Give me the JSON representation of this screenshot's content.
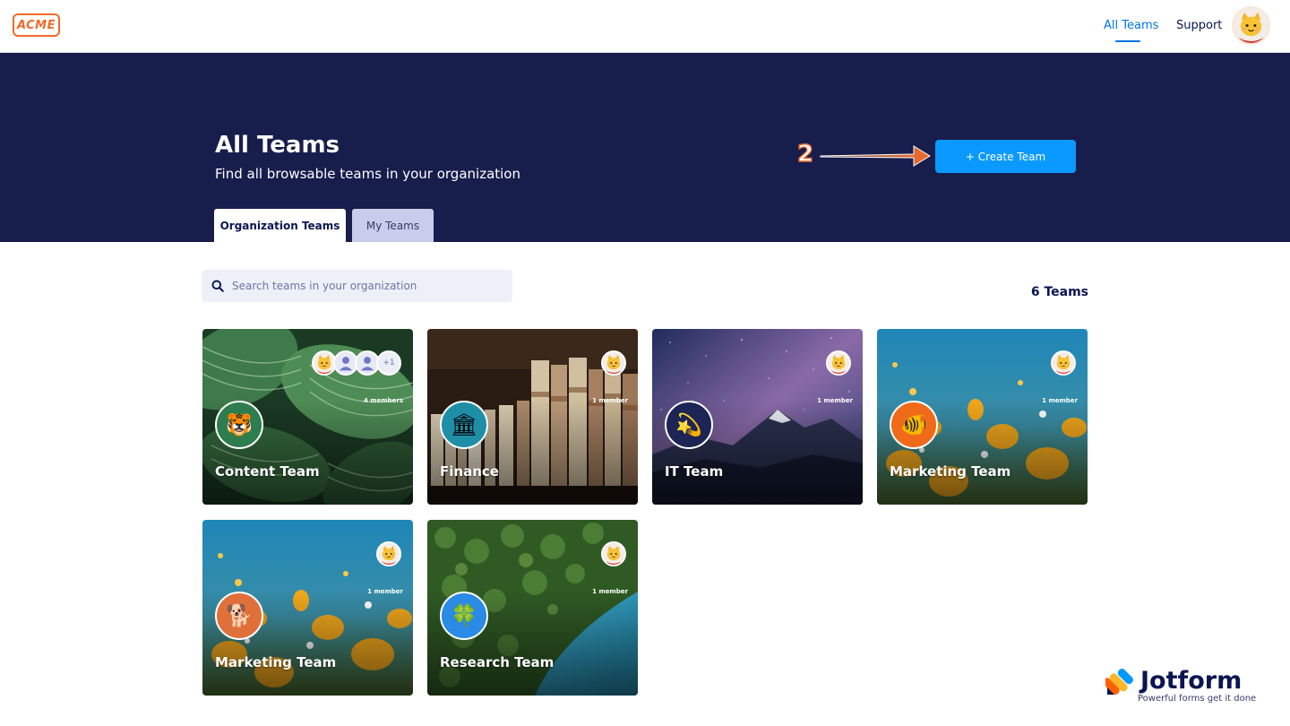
{
  "brand": {
    "logo_text": "ACME",
    "accent": "#f06a2a"
  },
  "nav": {
    "all_teams": "All Teams",
    "support": "Support",
    "avatar_icon": "cat-avatar-icon"
  },
  "hero": {
    "title": "All Teams",
    "subtitle": "Find all browsable teams in your organization",
    "create_button": "+ Create Team",
    "step_marker": "2",
    "background": "#171e4c",
    "button_color": "#0a99ff"
  },
  "tabs": [
    {
      "label": "Organization Teams",
      "active": true
    },
    {
      "label": "My Teams",
      "active": false
    }
  ],
  "search": {
    "placeholder": "Search teams in your organization",
    "value": ""
  },
  "team_count": "6 Teams",
  "teams": [
    {
      "name": "Content Team",
      "members": "4 members",
      "icon": "tiger-icon",
      "extra_members": "+1",
      "theme": "green-leaves"
    },
    {
      "name": "Finance",
      "members": "1 member",
      "icon": "bank-icon",
      "theme": "library-books"
    },
    {
      "name": "IT Team",
      "members": "1 member",
      "icon": "shooting-star-icon",
      "theme": "night-mountains"
    },
    {
      "name": "Marketing Team",
      "members": "1 member",
      "icon": "fish-icon",
      "theme": "yellow-flowers"
    },
    {
      "name": "Marketing Team",
      "members": "1 member",
      "icon": "dog-icon",
      "theme": "yellow-flowers"
    },
    {
      "name": "Research Team",
      "members": "1 member",
      "icon": "clover-icon",
      "theme": "forest-coast"
    }
  ],
  "watermark": {
    "name": "Jotform",
    "tagline": "Powerful forms get it done"
  }
}
